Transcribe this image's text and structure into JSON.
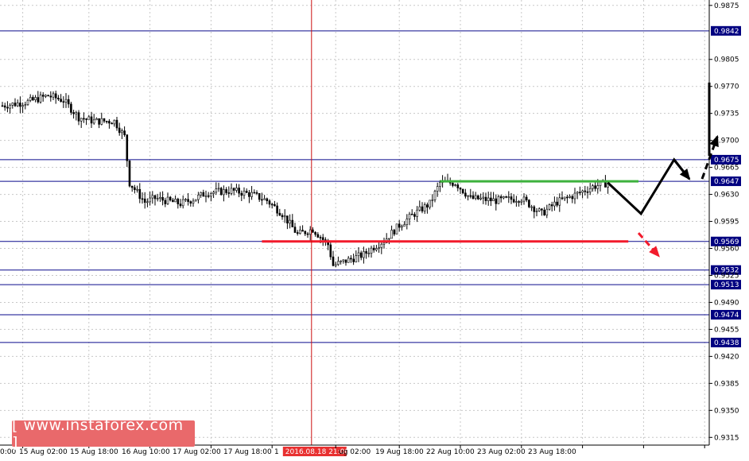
{
  "chart_data": {
    "type": "candlestick",
    "ylim": [
      0.9305,
      0.9882
    ],
    "y_ticks": [
      "0.9875",
      "0.9805",
      "0.9770",
      "0.9735",
      "0.9700",
      "0.9665",
      "0.9630",
      "0.9595",
      "0.9560",
      "0.9525",
      "0.9490",
      "0.9455",
      "0.9420",
      "0.9385",
      "0.9350",
      "0.9315"
    ],
    "x_ticks": [
      "0:00",
      "15 Aug 02:00",
      "15 Aug 18:00",
      "16 Aug 10:00",
      "17 Aug 02:00",
      "17 Aug 18:00",
      "1",
      "ug 02:00",
      "19 Aug 18:00",
      "22 Aug 10:00",
      "23 Aug 02:00",
      "23 Aug 18:00"
    ],
    "cursor": {
      "label": "2016.08.18 21:00",
      "index": 129
    },
    "last_price": 0.964,
    "levels": [
      {
        "value": 0.9842,
        "label": "0.9842"
      },
      {
        "value": 0.9675,
        "label": "0.9675"
      },
      {
        "value": 0.9647,
        "label": "0.9647"
      },
      {
        "value": 0.9569,
        "label": "0.9569"
      },
      {
        "value": 0.9532,
        "label": "0.9532"
      },
      {
        "value": 0.9513,
        "label": "0.9513"
      },
      {
        "value": 0.9474,
        "label": "0.9474"
      },
      {
        "value": 0.9438,
        "label": "0.9438"
      }
    ],
    "price_path": [
      [
        0,
        0.9745
      ],
      [
        10,
        0.975
      ],
      [
        18,
        0.9758
      ],
      [
        24,
        0.9752
      ],
      [
        30,
        0.973
      ],
      [
        36,
        0.9725
      ],
      [
        44,
        0.9725
      ],
      [
        48,
        0.9705
      ],
      [
        50,
        0.9645
      ],
      [
        56,
        0.962
      ],
      [
        60,
        0.9625
      ],
      [
        70,
        0.9618
      ],
      [
        76,
        0.9625
      ],
      [
        80,
        0.9632
      ],
      [
        90,
        0.9635
      ],
      [
        98,
        0.963
      ],
      [
        104,
        0.9622
      ],
      [
        110,
        0.9605
      ],
      [
        116,
        0.9578
      ],
      [
        122,
        0.9585
      ],
      [
        128,
        0.9565
      ],
      [
        130,
        0.9538
      ],
      [
        136,
        0.9545
      ],
      [
        142,
        0.9552
      ],
      [
        146,
        0.9562
      ],
      [
        150,
        0.957
      ],
      [
        156,
        0.959
      ],
      [
        162,
        0.9605
      ],
      [
        168,
        0.9618
      ],
      [
        172,
        0.9645
      ],
      [
        178,
        0.9645
      ],
      [
        184,
        0.9625
      ],
      [
        194,
        0.9622
      ],
      [
        204,
        0.9625
      ],
      [
        212,
        0.9605
      ],
      [
        218,
        0.962
      ],
      [
        224,
        0.9628
      ],
      [
        232,
        0.964
      ],
      [
        238,
        0.9645
      ]
    ],
    "resistance": {
      "value": 0.9647,
      "from": 172,
      "to": 250,
      "color": "#3db13d"
    },
    "support": {
      "value": 0.9569,
      "from": 102,
      "to": 246,
      "color": "#f21b2c"
    },
    "forecast_path": [
      [
        238,
        0.9645
      ],
      [
        251,
        0.9605
      ],
      [
        264,
        0.9675
      ],
      [
        270,
        0.965
      ]
    ],
    "forecast_up": [
      [
        275,
        0.965
      ],
      [
        281,
        0.9705
      ]
    ],
    "forecast_down": [
      [
        250,
        0.958
      ],
      [
        258,
        0.955
      ]
    ],
    "colors": {
      "level": "#0a0a8c",
      "cursor": "#cc1010",
      "candle": "#000000",
      "badge": "#000080",
      "cursor_badge": "#e83030"
    }
  },
  "watermark": {
    "text": "[ www.instaforex.com ]"
  }
}
